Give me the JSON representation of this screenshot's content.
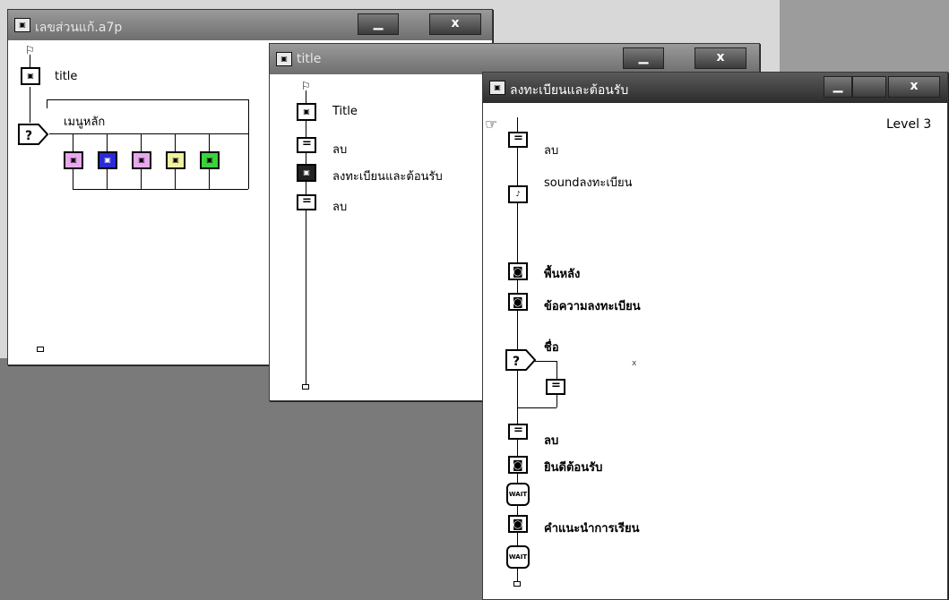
{
  "windows": {
    "main": {
      "title": "เลขส่วนแก้.a7p",
      "minimize": "▁",
      "close": "x"
    },
    "title": {
      "title": "title",
      "minimize": "▁",
      "close": "x"
    },
    "register": {
      "title": "ลงทะเบียนและต้อนรับ",
      "minimize": "▁",
      "close": "x",
      "level": "Level 3"
    }
  },
  "main_flow": {
    "items": [
      {
        "label": "title",
        "icon": "map-icon"
      },
      {
        "label": "เมนูหลัก",
        "icon": "decision-icon"
      }
    ],
    "branch_colors": [
      "#e8a8ee",
      "#2a2ad8",
      "#e8a8ee",
      "#f0f0a0",
      "#3cd23c"
    ]
  },
  "title_flow": {
    "items": [
      {
        "label": "Title",
        "icon": "map-icon"
      },
      {
        "label": "ลบ",
        "icon": "calculation-icon"
      },
      {
        "label": "ลงทะเบียนและต้อนรับ",
        "icon": "map-icon"
      },
      {
        "label": "ลบ",
        "icon": "calculation-icon"
      }
    ]
  },
  "register_flow": {
    "items": [
      {
        "label": "ลบ",
        "icon": "calculation-icon"
      },
      {
        "label": "soundลงทะเบียน",
        "icon": "sound-icon"
      },
      {
        "label": "พื้นหลัง",
        "icon": "display-icon"
      },
      {
        "label": "ข้อความลงทะเบียน",
        "icon": "display-icon"
      },
      {
        "label": "ชื่อ",
        "icon": "decision-icon"
      },
      {
        "label": "ลบ",
        "icon": "calculation-icon"
      },
      {
        "label": "ยินดีต้อนรับ",
        "icon": "display-icon"
      },
      {
        "label": "WAIT",
        "icon": "wait-icon"
      },
      {
        "label": "คำแนะนำการเรียน",
        "icon": "display-icon"
      },
      {
        "label": "WAIT",
        "icon": "wait-icon"
      }
    ],
    "mark": "x"
  }
}
